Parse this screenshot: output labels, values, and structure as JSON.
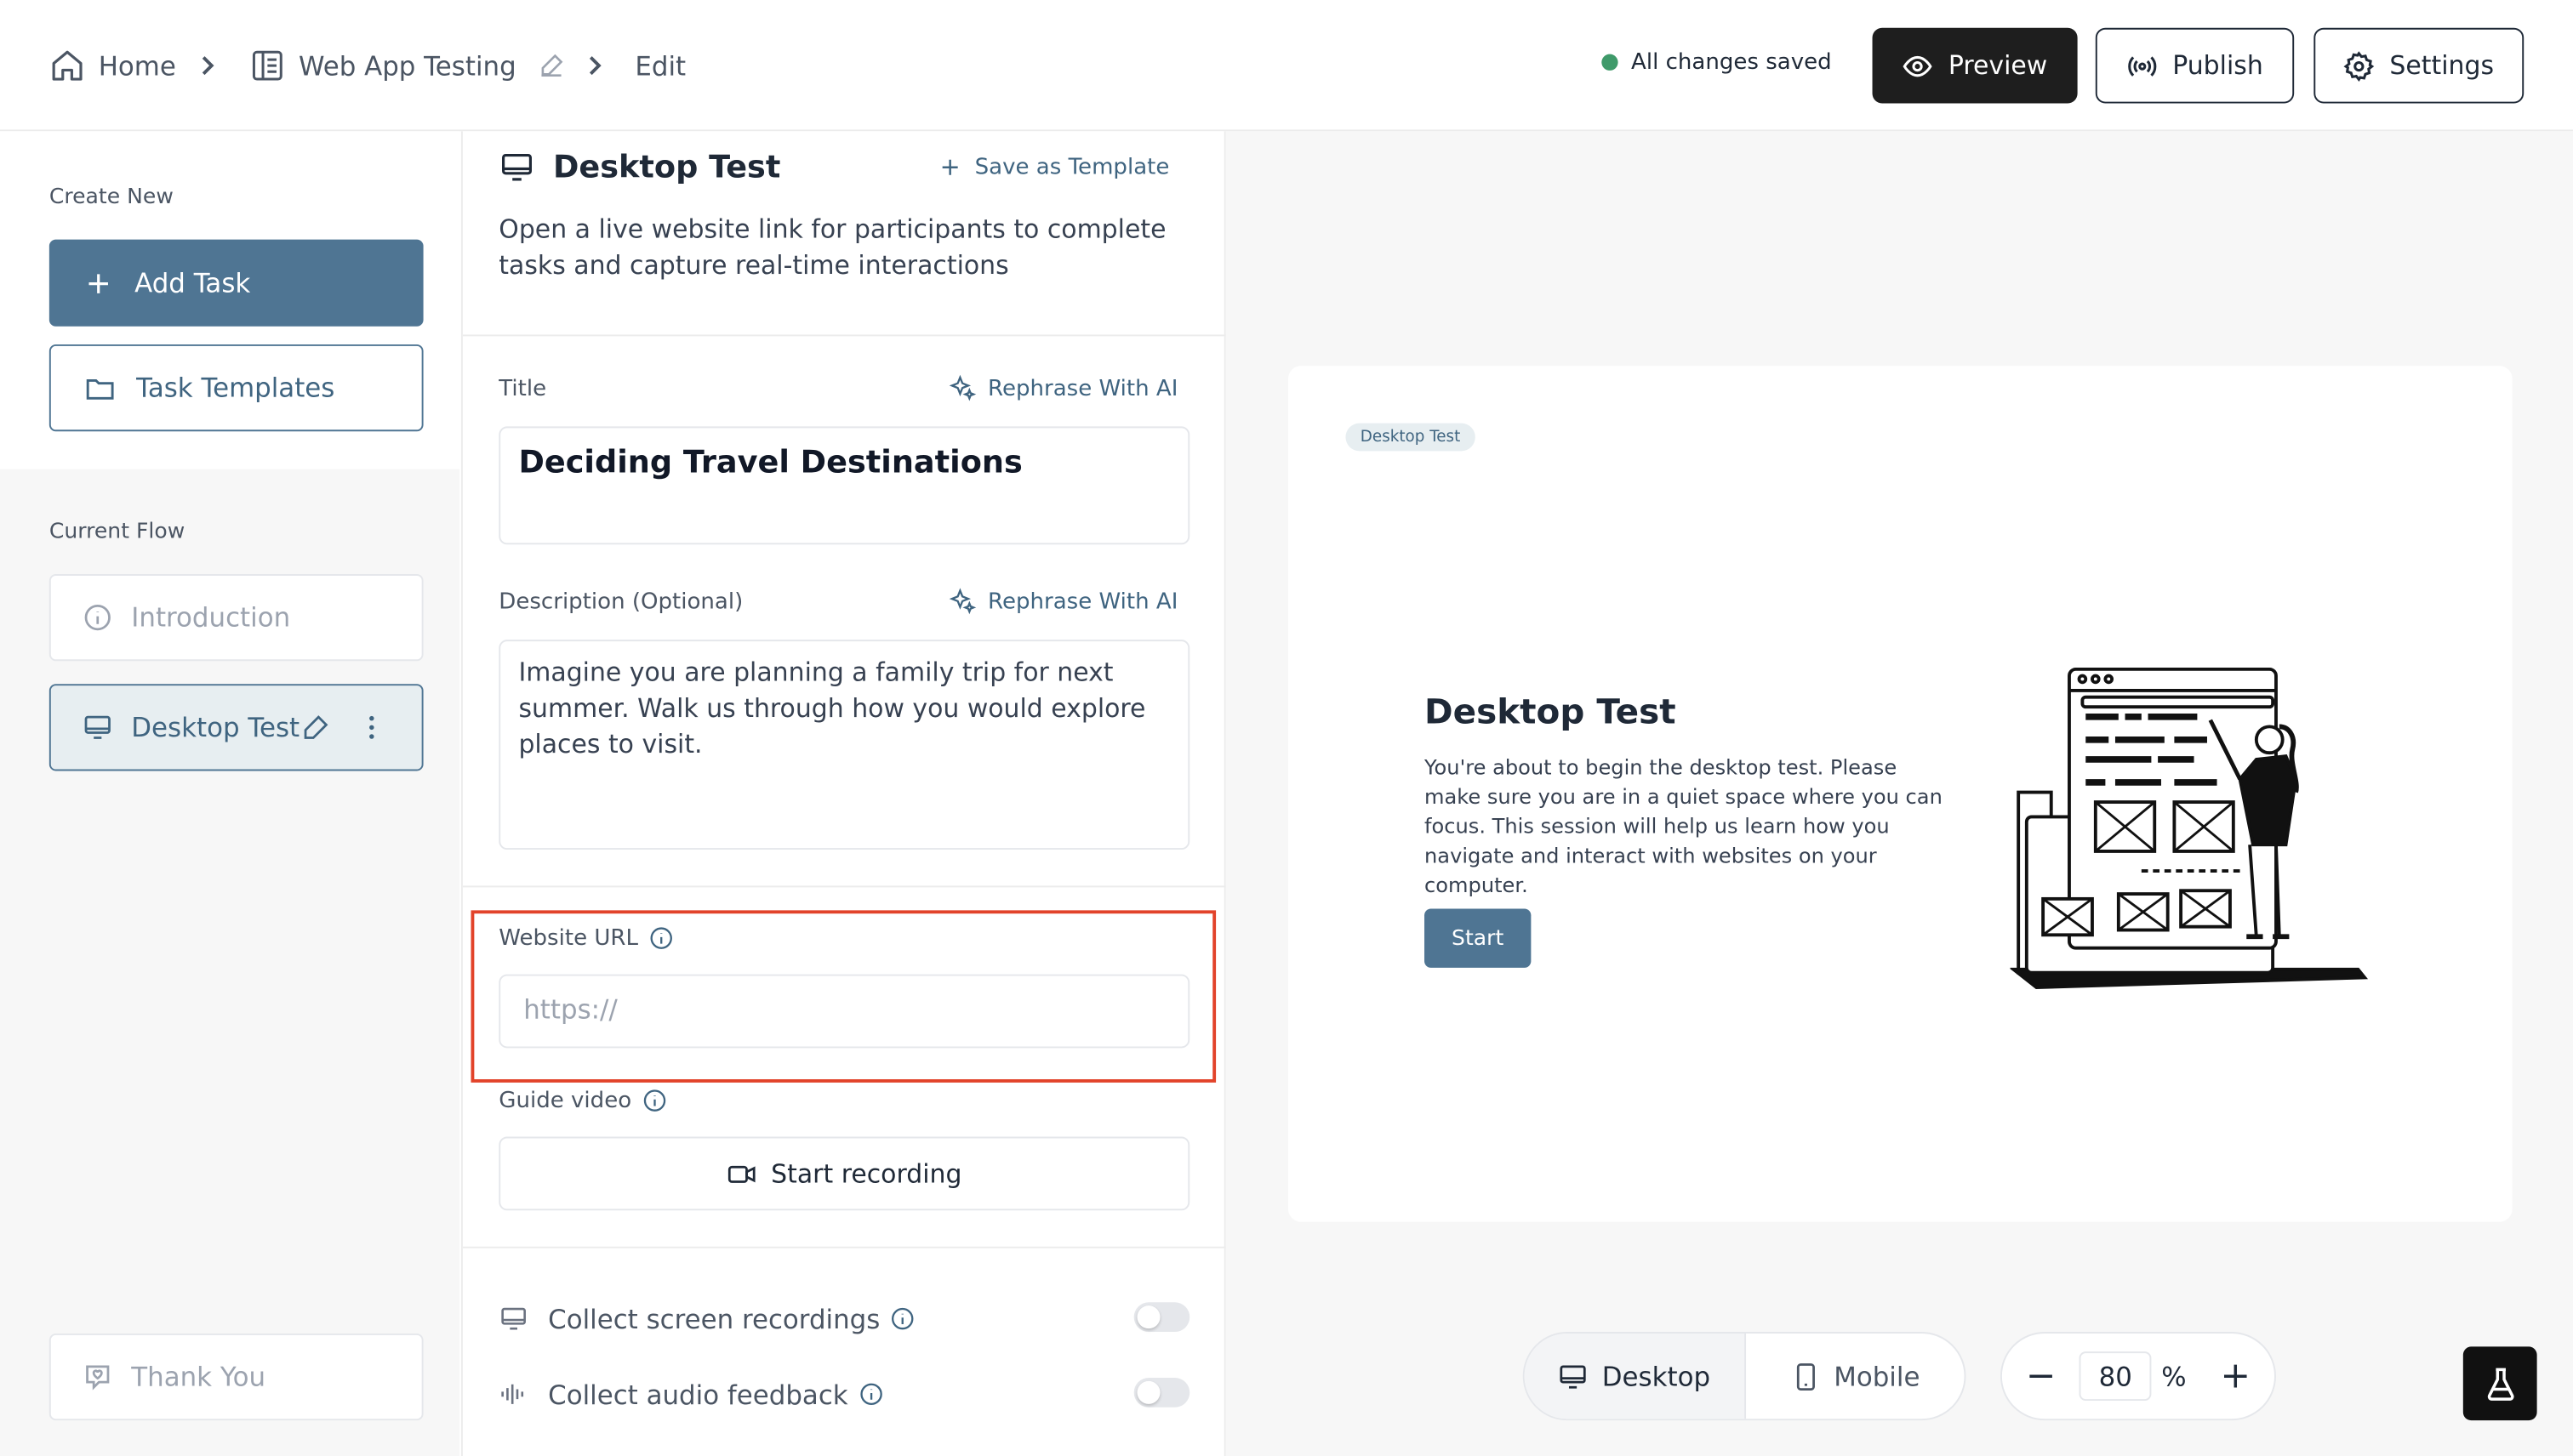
{
  "breadcrumb": {
    "home": "Home",
    "project": "Web App Testing",
    "current": "Edit"
  },
  "header": {
    "status": "All changes saved",
    "preview_label": "Preview",
    "publish_label": "Publish",
    "settings_label": "Settings"
  },
  "sidebar": {
    "create_new_label": "Create New",
    "add_task_label": "Add Task",
    "task_templates_label": "Task Templates",
    "current_flow_label": "Current Flow",
    "flow_items": [
      {
        "label": "Introduction",
        "icon": "info-icon",
        "active": false
      },
      {
        "label": "Desktop Test",
        "icon": "monitor-icon",
        "active": true
      }
    ],
    "thank_you_label": "Thank You"
  },
  "editor": {
    "heading": "Desktop Test",
    "save_template_label": "Save as Template",
    "intro": "Open a live website link for participants to complete tasks and capture real-time interactions",
    "title_label": "Title",
    "rephrase_label": "Rephrase With AI",
    "title_value": "Deciding Travel Destinations",
    "description_label": "Description (Optional)",
    "description_value": "Imagine you are planning a family trip for next summer. Walk us through how you would explore places to visit.",
    "url_label": "Website URL",
    "url_placeholder": "https://",
    "guide_video_label": "Guide video",
    "start_recording_label": "Start recording",
    "collect_screen_label": "Collect screen recordings",
    "collect_audio_label": "Collect audio feedback"
  },
  "preview": {
    "badge": "Desktop Test",
    "title": "Desktop Test",
    "body": "You're about to begin the desktop test. Please make sure you are in a quiet space where you can focus. This session will help us learn how you navigate and interact with websites on your computer.",
    "start_label": "Start",
    "desktop_label": "Desktop",
    "mobile_label": "Mobile",
    "zoom_value": "80",
    "zoom_unit": "%",
    "zoom_minus": "−",
    "zoom_plus": "+"
  },
  "colors": {
    "accent": "#4f7593",
    "status_ok": "#3f9a6a",
    "highlight": "#e2432a",
    "dark": "#1e1e1e"
  }
}
